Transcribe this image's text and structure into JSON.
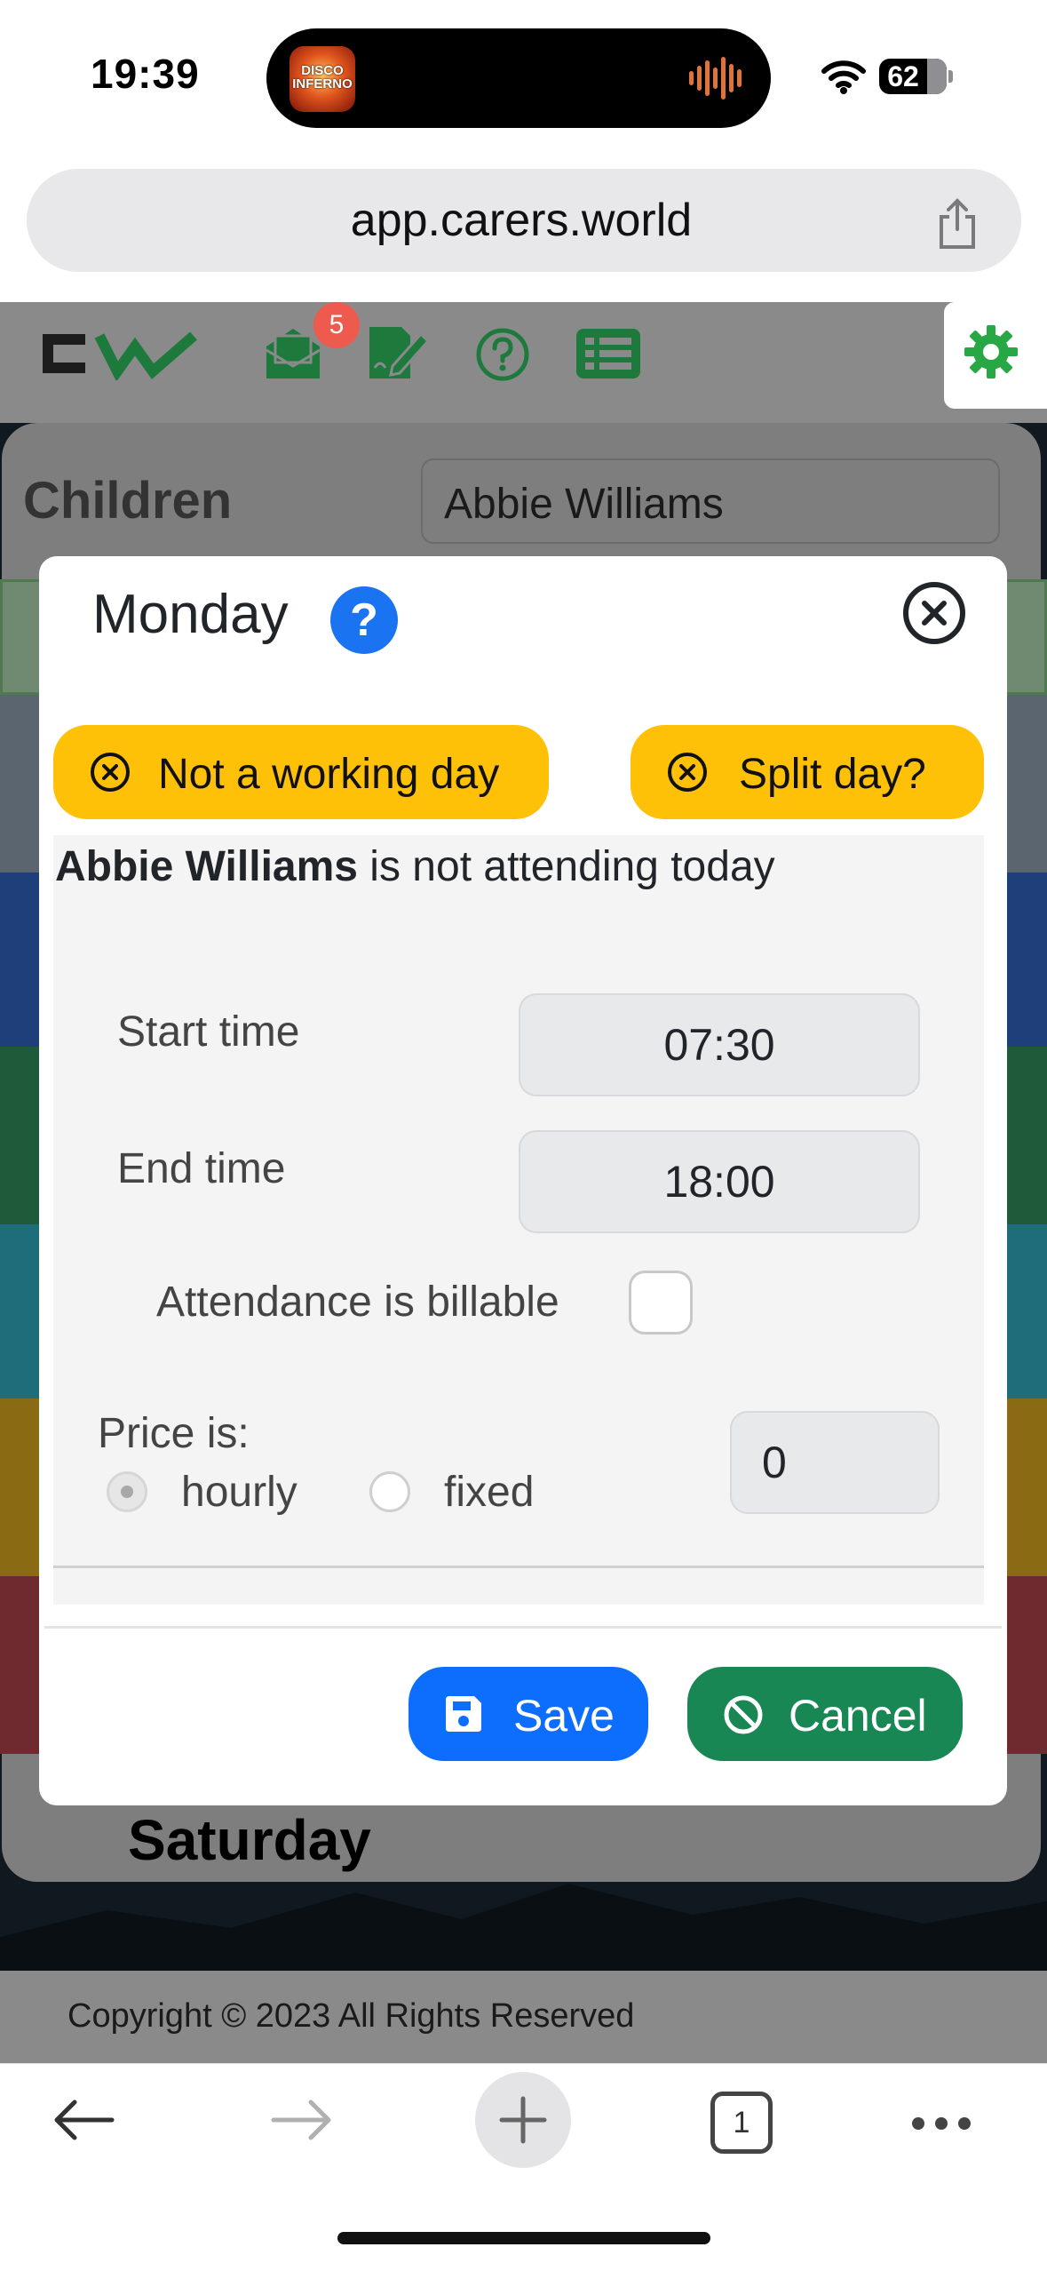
{
  "status": {
    "time": "19:39",
    "battery_level": "62",
    "island_art_text": "DISCO INFERNO"
  },
  "browser": {
    "url": "app.carers.world",
    "tab_count": "1"
  },
  "header": {
    "logo_text": "CW",
    "notification_count": "5",
    "icons": [
      "mail-icon",
      "signature-icon",
      "help-icon",
      "list-icon",
      "gear-icon"
    ],
    "accent_color": "#28a745"
  },
  "background": {
    "children_label": "Children",
    "selected_child": "Abbie Williams",
    "stripe_colors": [
      "#5b6570",
      "#2d4e8e",
      "#2f6f4f",
      "#2e8a96",
      "#a07c1f",
      "#8a3a3e"
    ],
    "saturday_label": "Saturday",
    "footer_text": "Copyright © 2023 All Rights Reserved"
  },
  "modal": {
    "title": "Monday",
    "help_label": "?",
    "not_working_day_label": "Not a working day",
    "split_day_label": "Split day?",
    "child_name": "Abbie Williams",
    "notice_text": " is not attending today",
    "start_time_label": "Start time",
    "start_time_value": "07:30",
    "end_time_label": "End time",
    "end_time_value": "18:00",
    "billable_label": "Attendance is billable",
    "billable_checked": false,
    "price_label": "Price is:",
    "price_options": [
      "hourly",
      "fixed"
    ],
    "price_selected": "hourly",
    "price_value": "0",
    "save_label": "Save",
    "cancel_label": "Cancel",
    "colors": {
      "yellow": "#ffc107",
      "primary": "#0d6efd",
      "success": "#198754"
    }
  }
}
